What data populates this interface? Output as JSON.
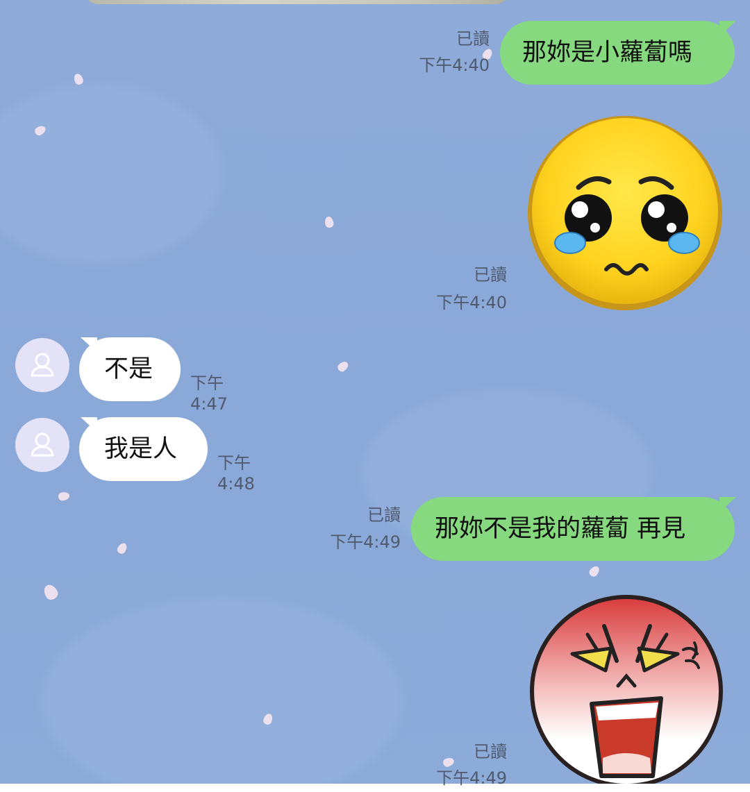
{
  "messages": [
    {
      "id": "m1",
      "direction": "outgoing",
      "type": "text",
      "text": "那妳是小蘿蔔嗎",
      "read": "已讀",
      "time": "下午4:40"
    },
    {
      "id": "m2",
      "direction": "outgoing",
      "type": "sticker",
      "sticker": "pleading-crying-face-icon",
      "read": "已讀",
      "time": "下午4:40"
    },
    {
      "id": "m3",
      "direction": "incoming",
      "type": "text",
      "text": "不是",
      "time": "下午4:47",
      "avatar": "default-user-avatar-icon"
    },
    {
      "id": "m4",
      "direction": "incoming",
      "type": "text",
      "text": "我是人",
      "time": "下午4:48",
      "avatar": "default-user-avatar-icon"
    },
    {
      "id": "m5",
      "direction": "outgoing",
      "type": "text",
      "text": "那妳不是我的蘿蔔 再見",
      "read": "已讀",
      "time": "下午4:49"
    },
    {
      "id": "m6",
      "direction": "outgoing",
      "type": "sticker",
      "sticker": "angry-shouting-face-icon",
      "read": "已讀",
      "time": "下午4:49"
    }
  ],
  "colors": {
    "background": "#8aa8d8",
    "outgoing_bubble": "#86d97e",
    "incoming_bubble": "#ffffff",
    "meta_text": "#4f5a6e",
    "avatar_bg": "#e3e2f7"
  }
}
